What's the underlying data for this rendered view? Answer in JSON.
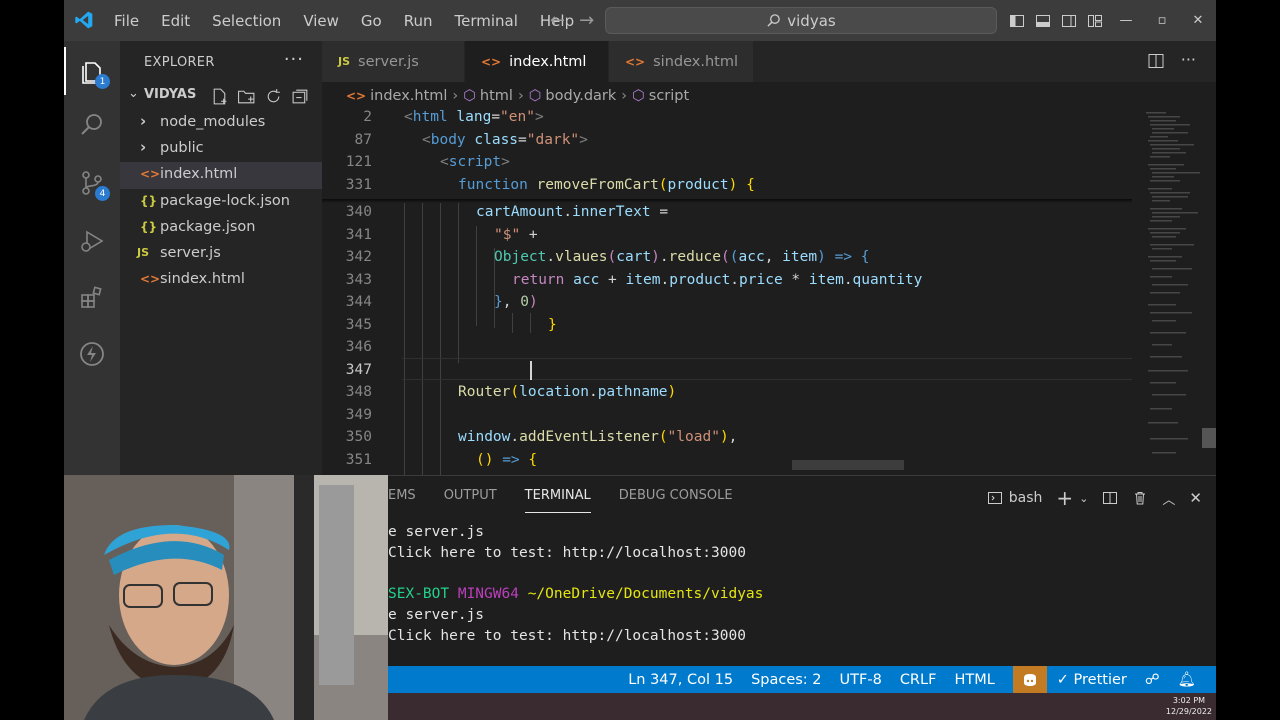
{
  "titlebar": {
    "menu": [
      "File",
      "Edit",
      "Selection",
      "View",
      "Go",
      "Run",
      "Terminal",
      "Help"
    ],
    "search": "vidyas"
  },
  "activity": {
    "explorer_badge": "1",
    "scm_badge": "4"
  },
  "sidebar": {
    "header": "EXPLORER",
    "folder": "VIDYAS",
    "items": [
      {
        "icon": "›",
        "label": "node_modules"
      },
      {
        "icon": "›",
        "label": "public"
      },
      {
        "icon": "<>",
        "label": "index.html"
      },
      {
        "icon": "{}",
        "label": "package-lock.json"
      },
      {
        "icon": "{}",
        "label": "package.json"
      },
      {
        "icon": "JS",
        "label": "server.js"
      },
      {
        "icon": "<>",
        "label": "sindex.html"
      }
    ]
  },
  "tabs": [
    {
      "icon": "JS",
      "label": "server.js"
    },
    {
      "icon": "<>",
      "label": "index.html"
    },
    {
      "icon": "<>",
      "label": "sindex.html"
    }
  ],
  "breadcrumb": [
    "index.html",
    "html",
    "body.dark",
    "script"
  ],
  "editor": {
    "line_numbers": [
      "2",
      "87",
      "121",
      "331",
      "340",
      "341",
      "342",
      "343",
      "344",
      "345",
      "346",
      "347",
      "348",
      "349",
      "350",
      "351"
    ]
  },
  "panel": {
    "tabs": [
      "EMS",
      "OUTPUT",
      "TERMINAL",
      "DEBUG CONSOLE"
    ],
    "shell": "bash",
    "terminal": {
      "l1": "e server.js",
      "l2": "Click here to test: http://localhost:3000",
      "host": "SEX-BOT",
      "env": "MINGW64",
      "path": "~/OneDrive/Documents/vidyas",
      "l4": "e server.js",
      "l5": "Click here to test: http://localhost:3000"
    }
  },
  "status": {
    "position": "Ln 347, Col 15",
    "spaces": "Spaces: 2",
    "encoding": "UTF-8",
    "eol": "CRLF",
    "language": "HTML",
    "prettier": "✓ Prettier"
  },
  "taskbar": {
    "time": "3:02 PM",
    "date": "12/29/2022"
  },
  "colors": {
    "accent": "#007acc",
    "titlebar": "#3c3c3c",
    "editor_bg": "#1e1e1e"
  }
}
